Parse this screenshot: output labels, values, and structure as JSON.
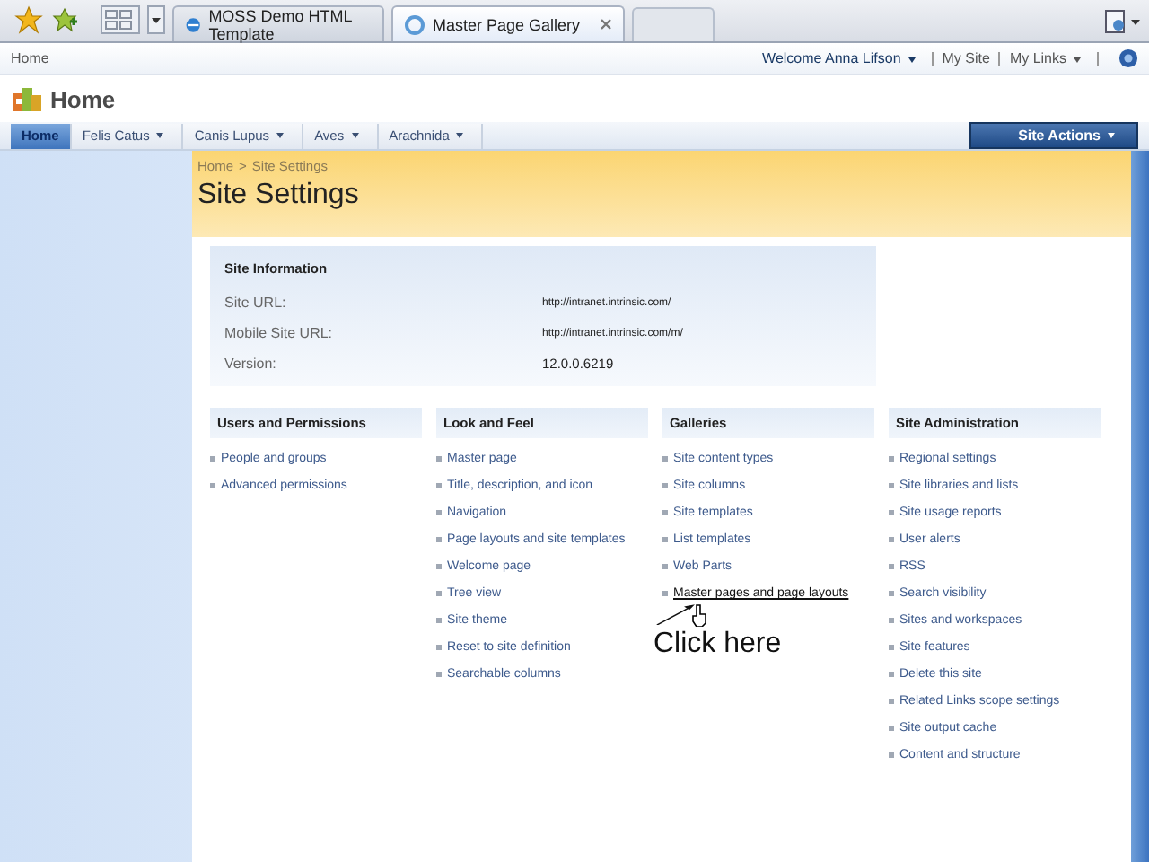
{
  "browser": {
    "tabs": [
      {
        "title": "MOSS Demo HTML Template",
        "selected": false
      },
      {
        "title": "Master Page Gallery",
        "selected": true
      }
    ]
  },
  "top_bar": {
    "breadcrumb": "Home",
    "welcome": "Welcome Anna Lifson",
    "links": [
      "My Site",
      "My Links"
    ]
  },
  "site_title": "Home",
  "nav": {
    "tabs": [
      {
        "label": "Home",
        "selected": true,
        "dropdown": false
      },
      {
        "label": "Felis Catus",
        "selected": false,
        "dropdown": true
      },
      {
        "label": "Canis Lupus",
        "selected": false,
        "dropdown": true
      },
      {
        "label": "Aves",
        "selected": false,
        "dropdown": true
      },
      {
        "label": "Arachnida",
        "selected": false,
        "dropdown": true
      }
    ],
    "site_actions": "Site Actions"
  },
  "page": {
    "breadcrumb": [
      "Home",
      "Site Settings"
    ],
    "separator": ">",
    "title": "Site Settings"
  },
  "site_information": {
    "heading": "Site Information",
    "rows": [
      {
        "label": "Site URL:",
        "value": "http://intranet.intrinsic.com/"
      },
      {
        "label": "Mobile Site URL:",
        "value": "http://intranet.intrinsic.com/m/"
      },
      {
        "label": "Version:",
        "value": "12.0.0.6219"
      }
    ]
  },
  "sections": [
    {
      "heading": "Users and Permissions",
      "links": [
        {
          "label": "People and groups",
          "hovered": false
        },
        {
          "label": "Advanced permissions",
          "hovered": false
        }
      ]
    },
    {
      "heading": "Look and Feel",
      "links": [
        {
          "label": "Master page",
          "hovered": false
        },
        {
          "label": "Title, description, and icon",
          "hovered": false
        },
        {
          "label": "Navigation",
          "hovered": false
        },
        {
          "label": "Page layouts and site templates",
          "hovered": false
        },
        {
          "label": "Welcome page",
          "hovered": false
        },
        {
          "label": "Tree view",
          "hovered": false
        },
        {
          "label": "Site theme",
          "hovered": false
        },
        {
          "label": "Reset to site definition",
          "hovered": false
        },
        {
          "label": "Searchable columns",
          "hovered": false
        }
      ]
    },
    {
      "heading": "Galleries",
      "links": [
        {
          "label": "Site content types",
          "hovered": false
        },
        {
          "label": "Site columns",
          "hovered": false
        },
        {
          "label": "Site templates",
          "hovered": false
        },
        {
          "label": "List templates",
          "hovered": false
        },
        {
          "label": "Web Parts",
          "hovered": false
        },
        {
          "label": "Master pages and page layouts",
          "hovered": true
        }
      ]
    },
    {
      "heading": "Site Administration",
      "links": [
        {
          "label": "Regional settings",
          "hovered": false
        },
        {
          "label": "Site libraries and lists",
          "hovered": false
        },
        {
          "label": "Site usage reports",
          "hovered": false
        },
        {
          "label": "User alerts",
          "hovered": false
        },
        {
          "label": "RSS",
          "hovered": false
        },
        {
          "label": "Search visibility",
          "hovered": false
        },
        {
          "label": "Sites and workspaces",
          "hovered": false
        },
        {
          "label": "Site features",
          "hovered": false
        },
        {
          "label": "Delete this site",
          "hovered": false
        },
        {
          "label": "Related Links scope settings",
          "hovered": false
        },
        {
          "label": "Site output cache",
          "hovered": false
        },
        {
          "label": "Content and structure",
          "hovered": false
        }
      ]
    }
  ],
  "annotation": {
    "text": "Click here"
  }
}
